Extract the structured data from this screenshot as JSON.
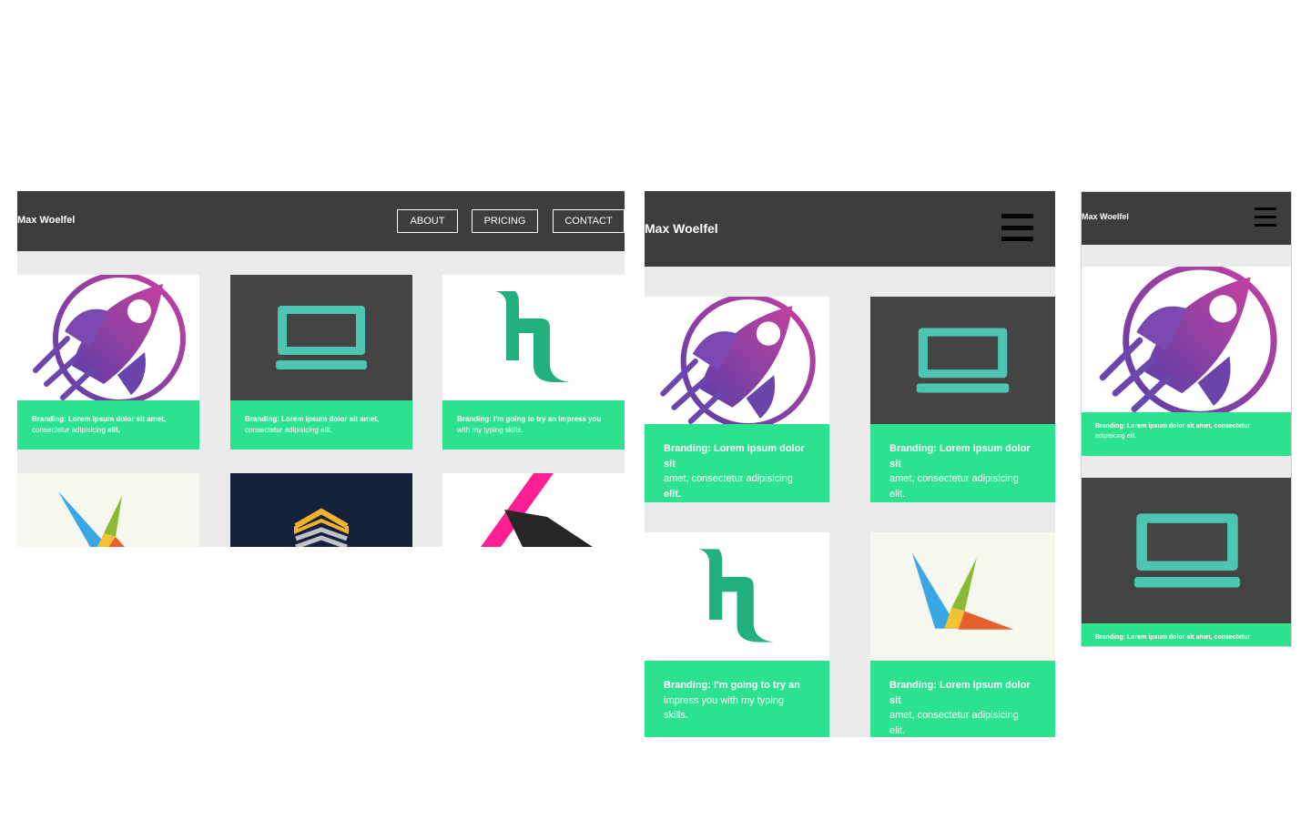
{
  "brand": {
    "name": "Max Woelfel"
  },
  "nav": {
    "about": "ABOUT",
    "pricing": "PRICING",
    "contact": "CONTACT"
  },
  "captions": {
    "rocket_prefix": "Branding: Lorem ipsum dolor sit amet,",
    "rocket_rest": "consectetur adipisicing",
    "rocket_end": "elit.",
    "laptop_prefix": "Branding: Lorem ipsum dolor sit amet,",
    "laptop_rest": "consectetur adipisicing elit.",
    "b_prefix": "Branding: I'm going to try an impress you",
    "b_rest": "with my typing skills.",
    "tablet_rocket_a": "Branding: Lorem ipsum dolor sit",
    "tablet_rocket_b": "amet, consectetur adipisicing",
    "tablet_rocket_c": "elit.",
    "tablet_laptop_a": "Branding: Lorem ipsum dolor sit",
    "tablet_laptop_b": "amet, consectetur adipisicing",
    "tablet_laptop_c": "elit.",
    "tablet_b_a": "Branding: I'm going to try an",
    "tablet_b_b": "impress you with my typing skills.",
    "tablet_k_a": "Branding: Lorem ipsum dolor sit",
    "tablet_k_b": "amet, consectetur adipisicing",
    "tablet_k_c": "elit.",
    "mobile_rocket_a": "Branding: Lorem ipsum dolor sit amet, consectetur",
    "mobile_rocket_b": "adipisicing elit.",
    "mobile_laptop_a": "Branding: Lorem ipsum dolor sit amet, consectetur"
  },
  "colors": {
    "header": "#3d3d3d",
    "caption": "#2ce28f",
    "background": "#ebebeb",
    "laptop_bg": "#444444",
    "teal": "#4cc6b2",
    "navy": "#13213a"
  },
  "icons": [
    "rocket-logo",
    "laptop-logo",
    "b-logo",
    "k-triangle-logo",
    "hexagon-stack-logo",
    "pink-k-logo",
    "hamburger-icon"
  ]
}
